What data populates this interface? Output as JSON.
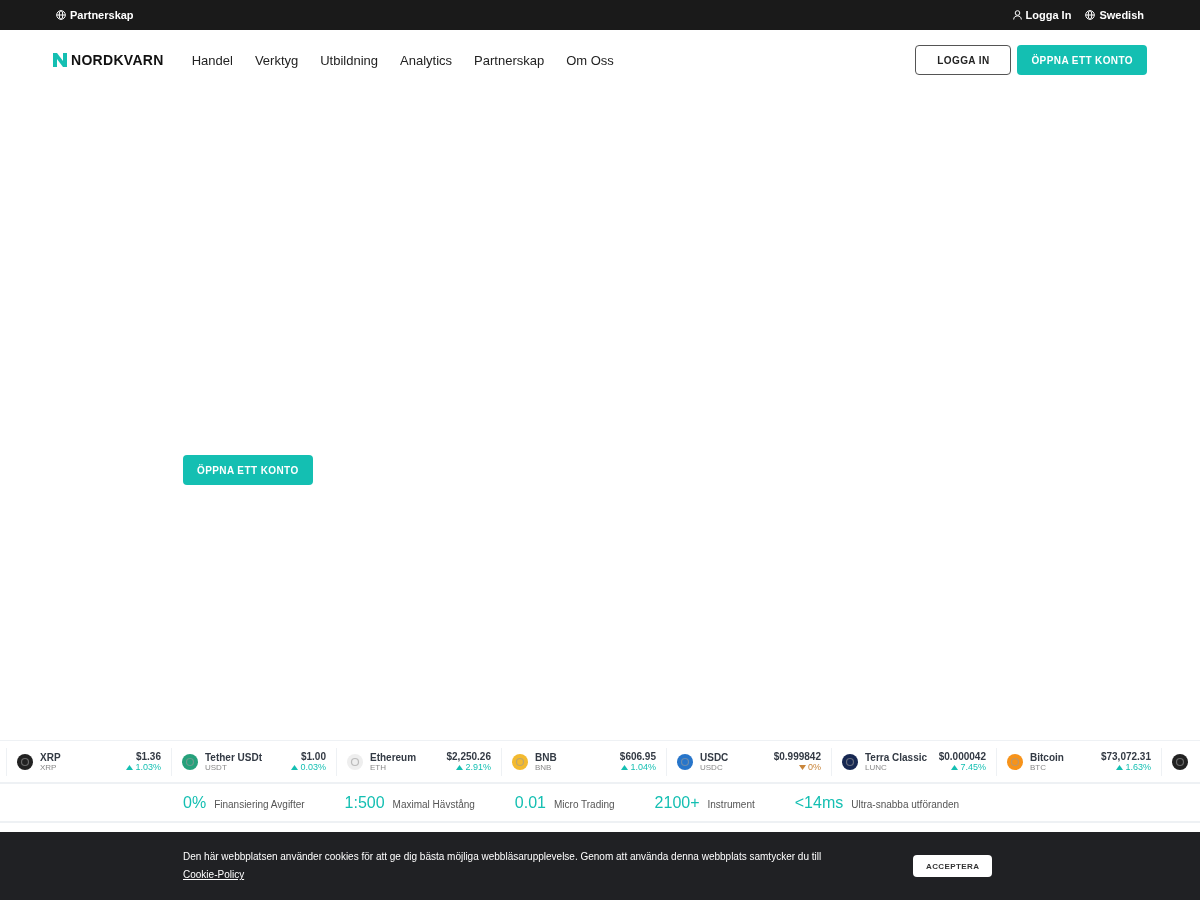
{
  "top_bar": {
    "left_link": "Partnerskap",
    "login": "Logga In",
    "language": "Swedish"
  },
  "nav": {
    "logo": "NORDKVARN",
    "items": [
      "Handel",
      "Verktyg",
      "Utbildning",
      "Analytics",
      "Partnerskap",
      "Om Oss"
    ],
    "login_button": "LOGGA IN",
    "open_button": "ÖPPNA ETT KONTO"
  },
  "hero": {
    "button": "ÖPPNA ETT KONTO"
  },
  "ticker": [
    {
      "name": "XRP",
      "symbol": "XRP",
      "price": "$1.36",
      "change": "1.03%",
      "rising": true,
      "color": "#222222"
    },
    {
      "name": "Tether USDt",
      "symbol": "USDT",
      "price": "$1.00",
      "change": "0.03%",
      "rising": true,
      "color": "#26a17b"
    },
    {
      "name": "Ethereum",
      "symbol": "ETH",
      "price": "$2,250.26",
      "change": "2.91%",
      "rising": true,
      "color": "#eeeeee"
    },
    {
      "name": "BNB",
      "symbol": "BNB",
      "price": "$606.95",
      "change": "1.04%",
      "rising": true,
      "color": "#f3ba2f"
    },
    {
      "name": "USDC",
      "symbol": "USDC",
      "price": "$0.999842",
      "change": "0%",
      "rising": false,
      "color": "#2775ca"
    },
    {
      "name": "Terra Classic",
      "symbol": "LUNC",
      "price": "$0.000042",
      "change": "7.45%",
      "rising": true,
      "color": "#172852"
    },
    {
      "name": "Bitcoin",
      "symbol": "BTC",
      "price": "$73,072.31",
      "change": "1.63%",
      "rising": true,
      "color": "#f7931a"
    },
    {
      "color": "#222222"
    }
  ],
  "stats": [
    {
      "value": "0%",
      "label": "Finansiering Avgifter"
    },
    {
      "value": "1:500",
      "label": "Maximal Hävstång"
    },
    {
      "value": "0.01",
      "label": "Micro Trading"
    },
    {
      "value": "2100+",
      "label": "Instrument"
    },
    {
      "value": "<14ms",
      "label": "Ultra-snabba utföranden"
    }
  ],
  "cookie_banner": {
    "text": "Den här webbplatsen använder cookies för att ge dig bästa möjliga webbläsarupplevelse. Genom att använda denna webbplats samtycker du till",
    "link": "Cookie-Policy",
    "button": "ACCEPTERA"
  }
}
